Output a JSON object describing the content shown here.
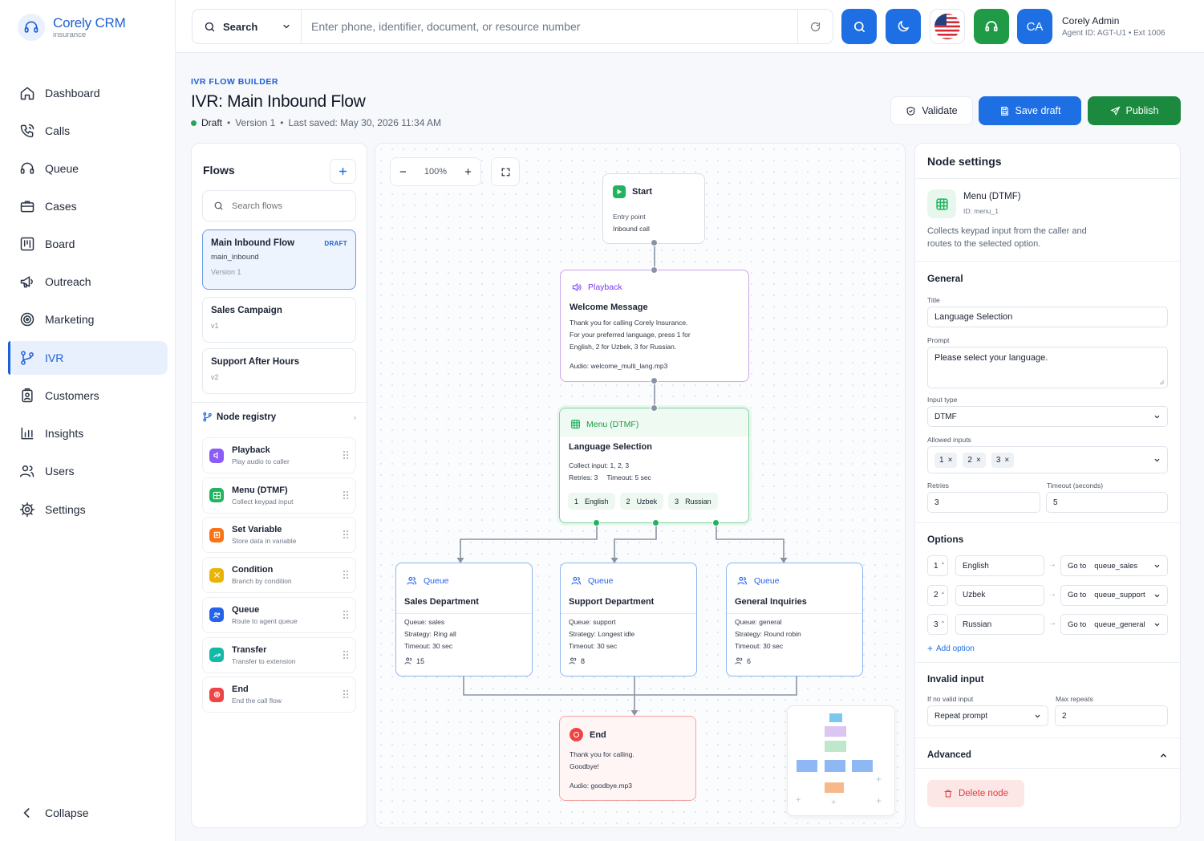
{
  "app": {
    "brand_name": "Corely CRM",
    "brand_sub": "insurance"
  },
  "sidebar": {
    "items": [
      {
        "label": "Dashboard",
        "icon": "home-icon"
      },
      {
        "label": "Calls",
        "icon": "phone-icon"
      },
      {
        "label": "Queue",
        "icon": "headset-icon"
      },
      {
        "label": "Cases",
        "icon": "briefcase-icon"
      },
      {
        "label": "Board",
        "icon": "kanban-icon"
      },
      {
        "label": "Outreach",
        "icon": "megaphone-icon"
      },
      {
        "label": "Marketing",
        "icon": "target-icon"
      },
      {
        "label": "IVR",
        "icon": "flow-icon"
      },
      {
        "label": "Customers",
        "icon": "clipboard-user-icon"
      },
      {
        "label": "Insights",
        "icon": "bar-chart-icon"
      },
      {
        "label": "Users",
        "icon": "users-icon"
      },
      {
        "label": "Settings",
        "icon": "gear-icon"
      }
    ],
    "active": "IVR",
    "collapse_label": "Collapse"
  },
  "topbar": {
    "search_type": "Search",
    "search_placeholder": "Enter phone, identifier, document, or resource number",
    "user_initials": "CA",
    "user_name": "Corely Admin",
    "user_meta": "Agent ID: AGT-U1 • Ext 1006",
    "colors": {
      "primary": "#1d6fe3",
      "success": "#1f9a47"
    }
  },
  "header": {
    "kicker": "IVR FLOW BUILDER",
    "title": "IVR: Main Inbound Flow",
    "status": "Draft",
    "version": "Version 1",
    "last_saved": "Last saved: May 30, 2026 11:34 AM",
    "validate_label": "Validate",
    "save_label": "Save draft",
    "publish_label": "Publish"
  },
  "flows": {
    "title": "Flows",
    "search_placeholder": "Search flows",
    "items": [
      {
        "name": "Main Inbound Flow",
        "id": "main_inbound",
        "version": "Version 1",
        "badge": "DRAFT"
      },
      {
        "name": "Sales Campaign",
        "version": "v1"
      },
      {
        "name": "Support After Hours",
        "version": "v2"
      }
    ]
  },
  "registry": {
    "title": "Node registry",
    "items": [
      {
        "name": "Playback",
        "desc": "Play audio to caller",
        "color": "#8b5cf6"
      },
      {
        "name": "Menu (DTMF)",
        "desc": "Collect keypad input",
        "color": "#22b35e"
      },
      {
        "name": "Set Variable",
        "desc": "Store data in variable",
        "color": "#f97316"
      },
      {
        "name": "Condition",
        "desc": "Branch by condition",
        "color": "#eab308"
      },
      {
        "name": "Queue",
        "desc": "Route to agent queue",
        "color": "#2563eb"
      },
      {
        "name": "Transfer",
        "desc": "Transfer to extension",
        "color": "#14b8a6"
      },
      {
        "name": "End",
        "desc": "End the call flow",
        "color": "#ef4444"
      }
    ]
  },
  "canvas": {
    "zoom": "100%",
    "start": {
      "label": "Start",
      "line1": "Entry point",
      "line2": "Inbound call"
    },
    "playback": {
      "type": "Playback",
      "title": "Welcome Message",
      "text1": "Thank you for calling Corely Insurance.",
      "text2": "For your preferred language, press 1 for",
      "text3": "English, 2 for Uzbek, 3 for Russian.",
      "audio": "Audio: welcome_multi_lang.mp3"
    },
    "menu": {
      "type": "Menu (DTMF)",
      "title": "Language Selection",
      "collect": "Collect input: 1, 2, 3",
      "retries": "Retries: 3",
      "timeout": "Timeout: 5 sec",
      "options": [
        {
          "key": "1",
          "label": "English"
        },
        {
          "key": "2",
          "label": "Uzbek"
        },
        {
          "key": "3",
          "label": "Russian"
        }
      ]
    },
    "queues": [
      {
        "type": "Queue",
        "title": "Sales Department",
        "queue_label": "Queue:",
        "queue": "sales",
        "strategy_label": "Strategy:",
        "strategy": "Ring all",
        "timeout": "Timeout: 30 sec",
        "agents": "15"
      },
      {
        "type": "Queue",
        "title": "Support Department",
        "queue_label": "Queue:",
        "queue": "support",
        "strategy_label": "Strategy:",
        "strategy": "Longest idle",
        "timeout": "Timeout: 30 sec",
        "agents": "8"
      },
      {
        "type": "Queue",
        "title": "General Inquiries",
        "queue_label": "Queue:",
        "queue": "general",
        "strategy_label": "Strategy:",
        "strategy": "Round robin",
        "timeout": "Timeout: 30 sec",
        "agents": "6"
      }
    ],
    "end": {
      "type": "End",
      "line1": "Thank you for calling.",
      "line2": "Goodbye!",
      "audio": "Audio: goodbye.mp3"
    }
  },
  "settings": {
    "title": "Node settings",
    "node_type": "Menu (DTMF)",
    "node_id": "ID: menu_1",
    "desc1": "Collects keypad input from the caller and",
    "desc2": "routes to the selected option.",
    "general_title": "General",
    "title_label": "Title",
    "title_value": "Language Selection",
    "prompt_label": "Prompt",
    "prompt_value": "Please select your language.",
    "input_type_label": "Input type",
    "input_type_value": "DTMF",
    "allowed_label": "Allowed inputs",
    "allowed": [
      "1",
      "2",
      "3"
    ],
    "retries_label": "Retries",
    "retries_value": "3",
    "timeout_label": "Timeout (seconds)",
    "timeout_value": "5",
    "options_title": "Options",
    "options": [
      {
        "key": "1",
        "label": "English",
        "goto": "Go to",
        "target": "queue_sales"
      },
      {
        "key": "2",
        "label": "Uzbek",
        "goto": "Go to",
        "target": "queue_support"
      },
      {
        "key": "3",
        "label": "Russian",
        "goto": "Go to",
        "target": "queue_general"
      }
    ],
    "add_option": "Add option",
    "invalid_title": "Invalid input",
    "no_valid_label": "If no valid input",
    "no_valid_value": "Repeat prompt",
    "max_repeats_label": "Max repeats",
    "max_repeats_value": "2",
    "advanced_title": "Advanced",
    "delete_label": "Delete node"
  }
}
